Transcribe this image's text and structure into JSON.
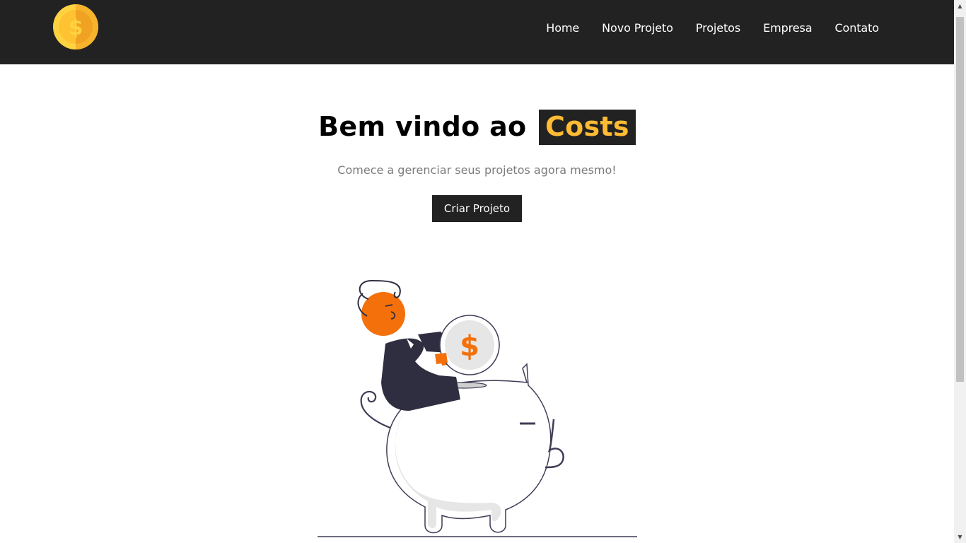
{
  "nav": {
    "items": [
      {
        "label": "Home"
      },
      {
        "label": "Novo Projeto"
      },
      {
        "label": "Projetos"
      },
      {
        "label": "Empresa"
      },
      {
        "label": "Contato"
      }
    ]
  },
  "logo": {
    "icon": "dollar-coin-icon",
    "symbol": "$"
  },
  "hero": {
    "title_prefix": "Bem vindo ao",
    "title_brand": "Costs",
    "subtitle": "Comece a gerenciar seus projetos agora mesmo!",
    "cta_label": "Criar Projeto"
  },
  "illustration": {
    "icon": "piggy-bank-savings-illustration",
    "coin_symbol": "$"
  },
  "colors": {
    "navbar": "#222222",
    "accent": "#ffbb33",
    "illustration_accent": "#f4700b",
    "subtitle": "#7b7b7b"
  }
}
